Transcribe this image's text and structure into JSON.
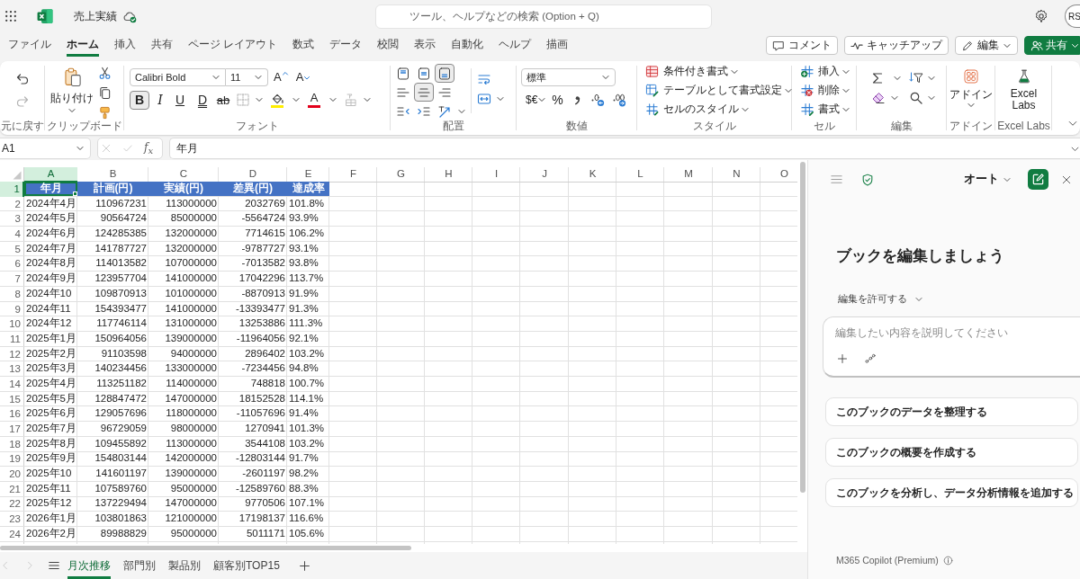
{
  "top_bar": {
    "title": "売上実績",
    "search": {
      "placeholder": "ツール、ヘルプなどの検索 (Option + Q)"
    },
    "avatar": "RS"
  },
  "menu_tabs": [
    {
      "label": "ファイル",
      "selected": false
    },
    {
      "label": "ホーム",
      "selected": true
    },
    {
      "label": "挿入",
      "selected": false
    },
    {
      "label": "共有",
      "selected": false
    },
    {
      "label": "ページ レイアウト",
      "selected": false
    },
    {
      "label": "数式",
      "selected": false
    },
    {
      "label": "データ",
      "selected": false
    },
    {
      "label": "校閲",
      "selected": false
    },
    {
      "label": "表示",
      "selected": false
    },
    {
      "label": "自動化",
      "selected": false
    },
    {
      "label": "ヘルプ",
      "selected": false
    },
    {
      "label": "描画",
      "selected": false
    }
  ],
  "actions": [
    {
      "kind": "comment",
      "label": "コメント"
    },
    {
      "kind": "catch_up",
      "label": "キャッチアップ"
    },
    {
      "kind": "edit",
      "label": "編集"
    },
    {
      "kind": "share",
      "label": "共有"
    }
  ],
  "ribbon_groups": [
    {
      "kind": "undo",
      "label": "元に戻す",
      "buttons": [
        {
          "kind": "undo",
          "disabled": false
        },
        {
          "kind": "redo",
          "disabled": true
        }
      ]
    },
    {
      "kind": "clipboard",
      "label": "クリップボード",
      "paste": "貼り付け"
    },
    {
      "kind": "font",
      "label": "フォント",
      "font_name": "Calibri Bold",
      "font_size": "11",
      "size_buttons": [
        {
          "kind": "grow",
          "label": "A"
        },
        {
          "kind": "shrink",
          "label": "A"
        }
      ],
      "styles": [
        {
          "kind": "bold",
          "label": "B",
          "selected": true
        },
        {
          "kind": "italic",
          "label": "I",
          "selected": false
        },
        {
          "kind": "underline",
          "label": "U",
          "selected": false
        },
        {
          "kind": "double_underline",
          "label": "D",
          "selected": false
        },
        {
          "kind": "strikethrough",
          "label": "ab",
          "selected": false
        }
      ],
      "color_tools": [
        {
          "kind": "fill",
          "color": "#ffee00"
        },
        {
          "kind": "font",
          "label": "A",
          "color": "#e3001b"
        }
      ],
      "phonetic": {
        "disabled": true
      }
    },
    {
      "kind": "alignment",
      "label": "配置",
      "vertical": [
        {
          "kind": "top",
          "selected": false
        },
        {
          "kind": "middle",
          "selected": false
        },
        {
          "kind": "bottom",
          "selected": true
        }
      ],
      "horizontal": [
        {
          "kind": "left",
          "selected": false
        },
        {
          "kind": "center",
          "selected": true
        },
        {
          "kind": "right",
          "selected": false
        }
      ]
    },
    {
      "kind": "number",
      "label": "数値",
      "format": "標準",
      "currency": "$€",
      "percent": "%"
    },
    {
      "kind": "styles",
      "label": "スタイル",
      "items": [
        {
          "kind": "conditional",
          "label": "条件付き書式"
        },
        {
          "kind": "table",
          "label": "テーブルとして書式設定"
        },
        {
          "kind": "cell_style",
          "label": "セルのスタイル"
        }
      ]
    },
    {
      "kind": "cells",
      "label": "セル",
      "items": [
        {
          "kind": "insert",
          "label": "挿入"
        },
        {
          "kind": "delete",
          "label": "削除"
        },
        {
          "kind": "format",
          "label": "書式"
        }
      ]
    },
    {
      "kind": "editing",
      "label": "編集"
    },
    {
      "kind": "addins",
      "label": "アドイン",
      "button": "アドイン"
    },
    {
      "kind": "labs",
      "label": "Excel Labs",
      "button": "Excel Labs"
    }
  ],
  "formula_bar": {
    "name_box": "A1",
    "buttons": [
      {
        "kind": "cancel",
        "disabled": true
      },
      {
        "kind": "enter",
        "disabled": true
      }
    ],
    "function": "f$_{x}$",
    "formula": "年月"
  },
  "sheet": {
    "columns": [
      {
        "label": "A",
        "selected": true
      },
      {
        "label": "B",
        "selected": false
      },
      {
        "label": "C",
        "selected": false
      },
      {
        "label": "D",
        "selected": false
      },
      {
        "label": "E",
        "selected": false
      },
      {
        "label": "F",
        "selected": false
      },
      {
        "label": "G",
        "selected": false
      },
      {
        "label": "H",
        "selected": false
      },
      {
        "label": "I",
        "selected": false
      },
      {
        "label": "J",
        "selected": false
      },
      {
        "label": "K",
        "selected": false
      },
      {
        "label": "L",
        "selected": false
      },
      {
        "label": "M",
        "selected": false
      },
      {
        "label": "N",
        "selected": false
      },
      {
        "label": "O",
        "selected": false
      }
    ],
    "rows": [
      {
        "number": "1",
        "kind": "header",
        "selected": true,
        "cells": [
          "年月",
          "計画(円)",
          "実績(円)",
          "差異(円)",
          "達成率"
        ]
      },
      {
        "number": "2",
        "kind": "data",
        "selected": false,
        "cells": [
          "2024年4月",
          "110967231",
          "113000000",
          "2032769",
          "101.8%"
        ]
      },
      {
        "number": "3",
        "kind": "data",
        "selected": false,
        "cells": [
          "2024年5月",
          "90564724",
          "85000000",
          "-5564724",
          "93.9%"
        ]
      },
      {
        "number": "4",
        "kind": "data",
        "selected": false,
        "cells": [
          "2024年6月",
          "124285385",
          "132000000",
          "7714615",
          "106.2%"
        ]
      },
      {
        "number": "5",
        "kind": "data",
        "selected": false,
        "cells": [
          "2024年7月",
          "141787727",
          "132000000",
          "-9787727",
          "93.1%"
        ]
      },
      {
        "number": "6",
        "kind": "data",
        "selected": false,
        "cells": [
          "2024年8月",
          "114013582",
          "107000000",
          "-7013582",
          "93.8%"
        ]
      },
      {
        "number": "7",
        "kind": "data",
        "selected": false,
        "cells": [
          "2024年9月",
          "123957704",
          "141000000",
          "17042296",
          "113.7%"
        ]
      },
      {
        "number": "8",
        "kind": "data",
        "selected": false,
        "cells": [
          "2024年10",
          "109870913",
          "101000000",
          "-8870913",
          "91.9%"
        ]
      },
      {
        "number": "9",
        "kind": "data",
        "selected": false,
        "cells": [
          "2024年11",
          "154393477",
          "141000000",
          "-13393477",
          "91.3%"
        ]
      },
      {
        "number": "10",
        "kind": "data",
        "selected": false,
        "cells": [
          "2024年12",
          "117746114",
          "131000000",
          "13253886",
          "111.3%"
        ]
      },
      {
        "number": "11",
        "kind": "data",
        "selected": false,
        "cells": [
          "2025年1月",
          "150964056",
          "139000000",
          "-11964056",
          "92.1%"
        ]
      },
      {
        "number": "12",
        "kind": "data",
        "selected": false,
        "cells": [
          "2025年2月",
          "91103598",
          "94000000",
          "2896402",
          "103.2%"
        ]
      },
      {
        "number": "13",
        "kind": "data",
        "selected": false,
        "cells": [
          "2025年3月",
          "140234456",
          "133000000",
          "-7234456",
          "94.8%"
        ]
      },
      {
        "number": "14",
        "kind": "data",
        "selected": false,
        "cells": [
          "2025年4月",
          "113251182",
          "114000000",
          "748818",
          "100.7%"
        ]
      },
      {
        "number": "15",
        "kind": "data",
        "selected": false,
        "cells": [
          "2025年5月",
          "128847472",
          "147000000",
          "18152528",
          "114.1%"
        ]
      },
      {
        "number": "16",
        "kind": "data",
        "selected": false,
        "cells": [
          "2025年6月",
          "129057696",
          "118000000",
          "-11057696",
          "91.4%"
        ]
      },
      {
        "number": "17",
        "kind": "data",
        "selected": false,
        "cells": [
          "2025年7月",
          "96729059",
          "98000000",
          "1270941",
          "101.3%"
        ]
      },
      {
        "number": "18",
        "kind": "data",
        "selected": false,
        "cells": [
          "2025年8月",
          "109455892",
          "113000000",
          "3544108",
          "103.2%"
        ]
      },
      {
        "number": "19",
        "kind": "data",
        "selected": false,
        "cells": [
          "2025年9月",
          "154803144",
          "142000000",
          "-12803144",
          "91.7%"
        ]
      },
      {
        "number": "20",
        "kind": "data",
        "selected": false,
        "cells": [
          "2025年10",
          "141601197",
          "139000000",
          "-2601197",
          "98.2%"
        ]
      },
      {
        "number": "21",
        "kind": "data",
        "selected": false,
        "cells": [
          "2025年11",
          "107589760",
          "95000000",
          "-12589760",
          "88.3%"
        ]
      },
      {
        "number": "22",
        "kind": "data",
        "selected": false,
        "cells": [
          "2025年12",
          "137229494",
          "147000000",
          "9770506",
          "107.1%"
        ]
      },
      {
        "number": "23",
        "kind": "data",
        "selected": false,
        "cells": [
          "2026年1月",
          "103801863",
          "121000000",
          "17198137",
          "116.6%"
        ]
      },
      {
        "number": "24",
        "kind": "data",
        "selected": false,
        "cells": [
          "2026年2月",
          "89988829",
          "95000000",
          "5011171",
          "105.6%"
        ]
      }
    ]
  },
  "sheet_nav": [
    {
      "kind": "prev",
      "disabled": true
    },
    {
      "kind": "next",
      "disabled": true
    }
  ],
  "sheet_tabs": [
    {
      "label": "月次推移",
      "selected": true
    },
    {
      "label": "部門別",
      "selected": false
    },
    {
      "label": "製品別",
      "selected": false
    },
    {
      "label": "顧客別TOP15",
      "selected": false
    }
  ],
  "copilot_panel": {
    "mode": "オート",
    "heading": "ブックを編集しましょう",
    "permission": "編集を許可する",
    "prompt": {
      "placeholder": "編集したい内容を説明してください"
    },
    "suggestions": [
      "このブックのデータを整理する",
      "このブックの概要を作成する",
      "このブックを分析し、データ分析情報を追加する"
    ],
    "footer": "M365 Copilot (Premium)"
  }
}
